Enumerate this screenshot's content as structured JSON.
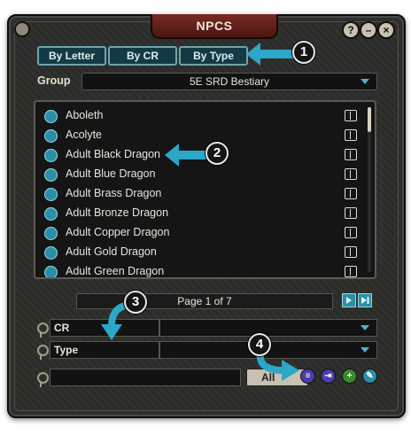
{
  "window": {
    "title": "NPCS"
  },
  "tabs": [
    {
      "label": "By Letter"
    },
    {
      "label": "By CR"
    },
    {
      "label": "By Type"
    }
  ],
  "group": {
    "label": "Group",
    "value": "5E SRD Bestiary"
  },
  "list": {
    "items": [
      {
        "name": "Aboleth"
      },
      {
        "name": "Acolyte"
      },
      {
        "name": "Adult Black Dragon"
      },
      {
        "name": "Adult Blue Dragon"
      },
      {
        "name": "Adult Brass Dragon"
      },
      {
        "name": "Adult Bronze Dragon"
      },
      {
        "name": "Adult Copper Dragon"
      },
      {
        "name": "Adult Gold Dragon"
      },
      {
        "name": "Adult Green Dragon"
      }
    ]
  },
  "pagination": {
    "text": "Page 1 of 7"
  },
  "filters": [
    {
      "label": "CR"
    },
    {
      "label": "Type"
    }
  ],
  "bottom": {
    "all_label": "All"
  },
  "callouts": [
    {
      "num": "1"
    },
    {
      "num": "2"
    },
    {
      "num": "3"
    },
    {
      "num": "4"
    }
  ],
  "colors": {
    "accent": "#2ba7c8",
    "title_tab": "#6b2620",
    "panel": "#2e2f2d"
  }
}
